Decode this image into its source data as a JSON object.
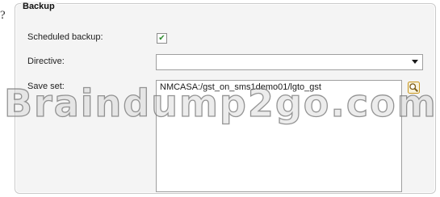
{
  "question_mark": "?",
  "backup_panel": {
    "title": "Backup",
    "scheduled_backup": {
      "label": "Scheduled backup:",
      "checked": true,
      "check_glyph": "✔"
    },
    "directive": {
      "label": "Directive:",
      "value": ""
    },
    "save_set": {
      "label": "Save set:",
      "value": "NMCASA:/gst_on_sms1demo01/lgto_gst"
    }
  },
  "watermark": "Braindump2go.com",
  "colors": {
    "check": "#2f8c2f",
    "browse_icon": "#c8961e"
  },
  "icons": {
    "browse": "magnifier-icon",
    "dropdown": "chevron-down-icon"
  }
}
